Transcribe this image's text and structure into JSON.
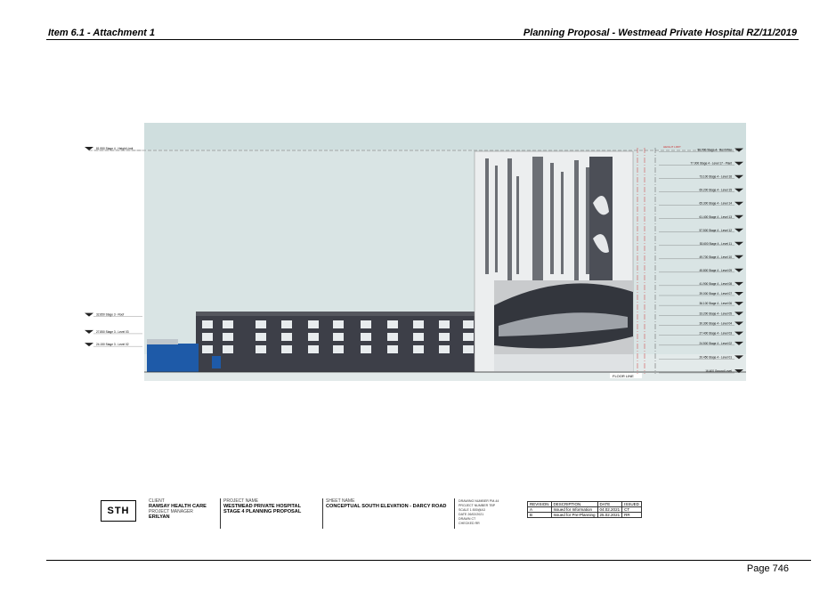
{
  "header": {
    "left": "Item 6.1 - Attachment 1",
    "right": "Planning Proposal - Westmead Private Hospital RZ/11/2019"
  },
  "drawing": {
    "left_levels": [
      "81.950 Stage 4 - Height Limit",
      "32.850 Stage 3 - Roof",
      "27.850 Stage 3 - Level 03",
      "24.150 Stage 3 - Level 02"
    ],
    "right_levels": [
      "80.900 Stage 4 - Roof Plan",
      "77.000 Stage 4 - Level 17 - Plant",
      "73.100 Stage 4 - Level 16",
      "69.200 Stage 4 - Level 15",
      "65.300 Stage 4 - Level 14",
      "61.400 Stage 4 - Level 13",
      "57.500 Stage 4 - Level 12",
      "53.600 Stage 4 - Level 11",
      "49.700 Stage 4 - Level 10",
      "45.800 Stage 4 - Level 09",
      "41.900 Stage 4 - Level 08",
      "39.000 Stage 4 - Level 07",
      "36.100 Stage 4 - Level 06",
      "33.200 Stage 4 - Level 05",
      "30.300 Stage 4 - Level 04",
      "27.400 Stage 4 - Level 03",
      "24.500 Stage 4 - Level 02",
      "20.450 Stage 4 - Level 01",
      "16.400 Ground Level"
    ],
    "floor_line": "FLOOR LINE",
    "hl_tag": "HEIGHT LIMIT"
  },
  "title_block": {
    "logo": "STH",
    "client_label": "CLIENT",
    "client": "RAMSAY HEALTH CARE",
    "pm_label": "PROJECT MANAGER",
    "pm": "ERILYAN",
    "project_label": "PROJECT NAME",
    "project_line1": "WESTMEAD PRIVATE HOSPITAL",
    "project_line2": "STAGE 4 PLANNING PROPOSAL",
    "sheet_label": "SHEET NAME",
    "sheet": "CONCEPTUAL SOUTH ELEVATION - DARCY ROAD",
    "info_lines": [
      "DRAWING NUMBER   PM-44",
      "PROJECT NUMBER   TBP",
      "SCALE            1:500@A3",
      "DATE             26/02/2021",
      "DRAWN            CT",
      "CHECKED          RR"
    ],
    "rev_header": [
      "REVISION",
      "DESCRIPTION",
      "DATE",
      "ISSUED"
    ],
    "rev_rows": [
      [
        "A",
        "Issued for Information",
        "04.02.2021",
        "CT"
      ],
      [
        "B",
        "Issued for Pre-Planning",
        "25.02.2021",
        "RR"
      ]
    ]
  },
  "footer": {
    "page": "Page 746"
  }
}
